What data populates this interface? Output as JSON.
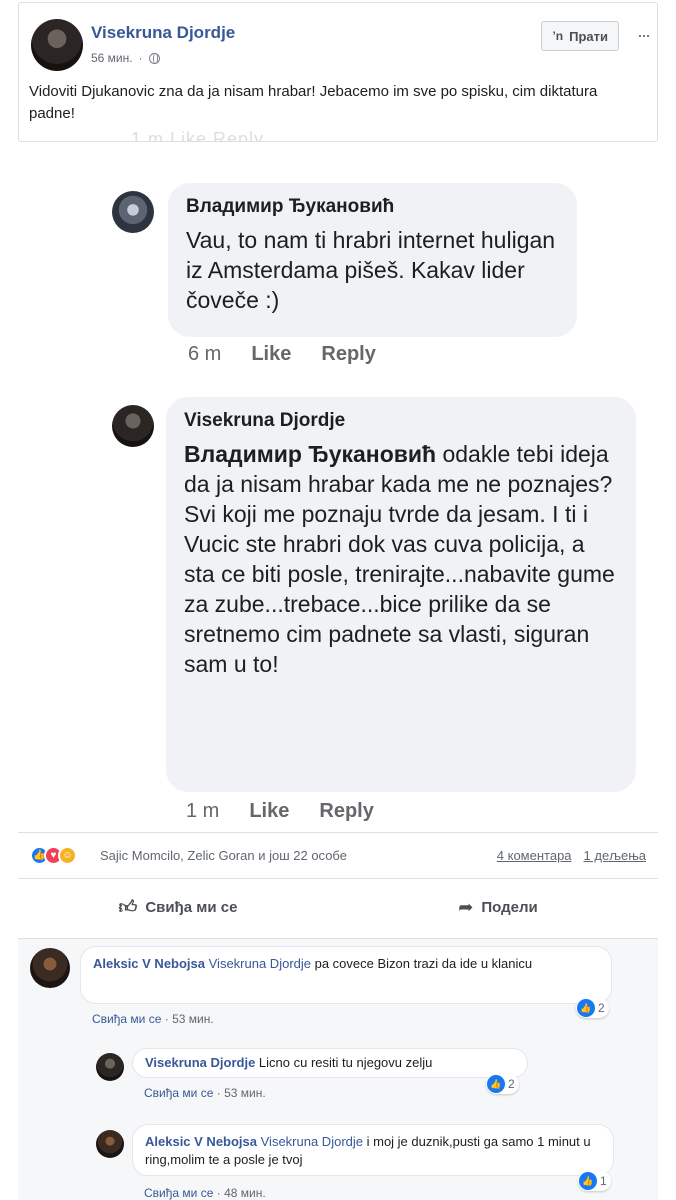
{
  "post": {
    "author": "Visekruna Djordje",
    "time": "56 мин.",
    "follow_label": "Прати",
    "text": "Vidoviti Djukanovic zna da ja nisam hrabar! Jebacemo im sve po spisku, cim diktatura padne!",
    "cut_row": "1 m   Like   Reply"
  },
  "screenshot_comments": [
    {
      "author": "Владимир Ђукановић",
      "text": "Vau, to nam ti hrabri internet huligan iz Amsterdama pišeš. Kakav lider čoveče :)",
      "time": "6 m",
      "like": "Like",
      "reply": "Reply"
    },
    {
      "author": "Visekruna Djordje",
      "mention": "Владимир Ђукановић",
      "text": " odakle tebi ideja da ja nisam hrabar kada me ne poznajes? Svi koji me poznaju tvrde da jesam. I ti i Vucic ste hrabri dok vas cuva policija, a sta ce biti posle, trenirajte...nabavite gume za zube...trebace...bice prilike da se sretnemo cim padnete sa vlasti, siguran sam u to!",
      "time": "1 m",
      "like": "Like",
      "reply": "Reply"
    }
  ],
  "reactions": {
    "icons": [
      "like-icon",
      "love-icon",
      "haha-icon"
    ],
    "text": "Sajic Momcilo, Zelic Goran и још 22 особе",
    "comments_count": "4 коментара",
    "shares_count": "1 дељења"
  },
  "actions": {
    "like_label": "Свиђа ми се",
    "share_label": "Подели"
  },
  "comments": [
    {
      "author": "Aleksic V Nebojsa",
      "tag": "Visekruna Djordje",
      "text": " pa covece Bizon trazi da ide u klanicu",
      "like_label": "Свиђа ми се",
      "time": "53 мин.",
      "likes": "2"
    },
    {
      "author": "Visekruna Djordje",
      "tag": "",
      "text": " Licno cu resiti tu njegovu zelju",
      "like_label": "Свиђа ми се",
      "time": "53 мин.",
      "likes": "2"
    },
    {
      "author": "Aleksic V Nebojsa",
      "tag": "Visekruna Djordje",
      "text": " i moj je duznik,pusti ga samo 1 minut u ring,molim te a posle je tvoj",
      "like_label": "Свиђа ми се",
      "time": "48 мин.",
      "likes": "1"
    }
  ],
  "colors": {
    "link": "#385898",
    "like_blue": "#1877f2",
    "love_red": "#f33e58",
    "haha_yellow": "#f7b125"
  }
}
